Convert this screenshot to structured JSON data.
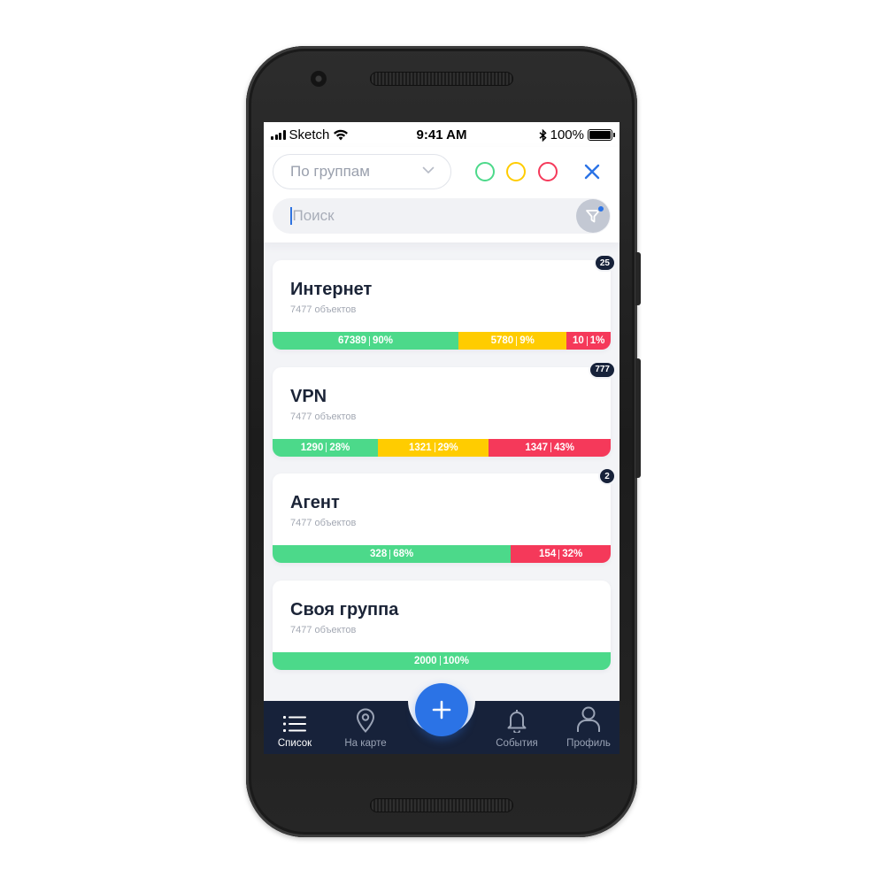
{
  "status_bar": {
    "carrier": "Sketch",
    "time": "9:41 AM",
    "battery": "100%"
  },
  "header": {
    "group_select": {
      "value": "По группам"
    },
    "search": {
      "placeholder": "Поиск"
    },
    "colors": {
      "green": "#4cd98a",
      "yellow": "#ffcc00",
      "red": "#f5395a",
      "accent": "#2b73e6"
    }
  },
  "cards": [
    {
      "title": "Интернет",
      "subtitle": "7477 объектов",
      "badge": "25",
      "segments": [
        {
          "color": "green",
          "count": "67389",
          "percent": "90%",
          "share": 0.55
        },
        {
          "color": "yellow",
          "count": "5780",
          "percent": "9%",
          "share": 0.32
        },
        {
          "color": "red",
          "count": "10",
          "percent": "1%",
          "share": 0.13
        }
      ]
    },
    {
      "title": "VPN",
      "subtitle": "7477 объектов",
      "badge": "777",
      "segments": [
        {
          "color": "green",
          "count": "1290",
          "percent": "28%",
          "share": 0.312
        },
        {
          "color": "yellow",
          "count": "1321",
          "percent": "29%",
          "share": 0.328
        },
        {
          "color": "red",
          "count": "1347",
          "percent": "43%",
          "share": 0.36
        }
      ]
    },
    {
      "title": "Агент",
      "subtitle": "7477 объектов",
      "badge": "2",
      "segments": [
        {
          "color": "green",
          "count": "328",
          "percent": "68%",
          "share": 0.705
        },
        {
          "color": "red",
          "count": "154",
          "percent": "32%",
          "share": 0.295
        }
      ]
    },
    {
      "title": "Своя группа",
      "subtitle": "7477 объектов",
      "badge": "",
      "segments": [
        {
          "color": "green",
          "count": "2000",
          "percent": "100%",
          "share": 1.0
        }
      ]
    }
  ],
  "nav": {
    "items": [
      {
        "label": "Список",
        "icon": "list-icon",
        "active": true
      },
      {
        "label": "На карте",
        "icon": "map-pin-icon",
        "active": false
      },
      {
        "label": "События",
        "icon": "bell-icon",
        "active": false
      },
      {
        "label": "Профиль",
        "icon": "user-icon",
        "active": false
      }
    ],
    "fab_icon": "plus-icon"
  }
}
